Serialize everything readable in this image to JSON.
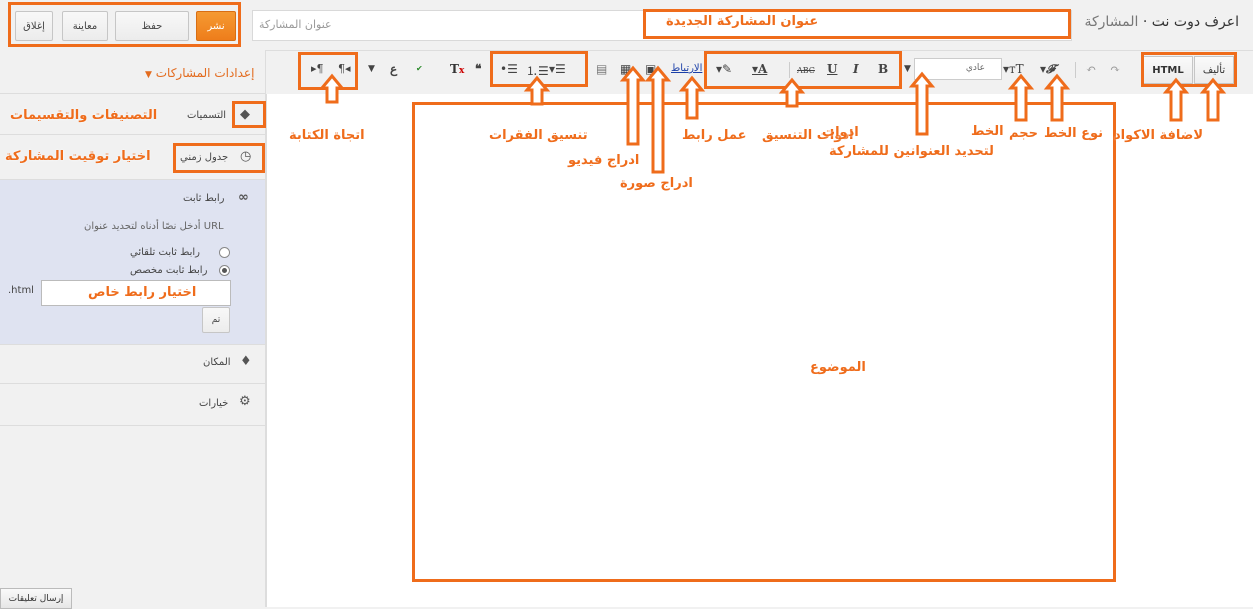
{
  "header": {
    "blog_title": "اعرف دوت نت",
    "separator": "·",
    "section": "المشاركة",
    "title_placeholder": "عنوان المشاركة",
    "buttons": {
      "publish": "نشر",
      "save": "حفظ",
      "preview": "معاينة",
      "close": "إغلاق"
    }
  },
  "toolbar": {
    "compose_label": "تأليف",
    "html_label": "HTML",
    "heading_select": "عادي",
    "link_label": "الارتباط",
    "bold": "B",
    "italic": "I",
    "underline": "U",
    "strike": "ABC",
    "font_color": "A",
    "quote": "❝",
    "clear_format": "T",
    "spell": "ABC",
    "rtl": "¶◂",
    "ltr": "▸¶"
  },
  "sidebar": {
    "settings_title": "إعدادات المشاركات",
    "labels_item": "التسميات",
    "schedule_item": "جدول زمني",
    "permalink_item": "رابط ثابت",
    "permalink_hint": "أدخل نصًا أدناه لتحديد عنوان URL",
    "radio_auto": "رابط ثابت تلقائي",
    "radio_custom": "رابط ثابت مخصص",
    "url_suffix": ".html",
    "done_button": "تم",
    "location_item": "المكان",
    "options_item": "خيارات"
  },
  "footer": {
    "feedback": "إرسال تعليقات"
  },
  "annotations": {
    "new_post_title": "عنوان المشاركة الجديدة",
    "categories": "التصنيفات والتقسيمات",
    "post_timing": "اختيار توقيت المشاركة",
    "custom_link": "اختيار رابط خاص",
    "writing_direction": "اتجاة الكتابة",
    "paragraph_format": "تنسيق الفقرات",
    "insert_video": "ادراج فيديو",
    "insert_image": "ادراج صورة",
    "make_link": "عمل رابط",
    "format_tools": "ادوات التنسيق",
    "headings_line1": "ادوات",
    "headings_line2": "لتحديد العنوانين للمشاركة",
    "font_size_line1": "الخط",
    "font_size_line2": "حجم",
    "font_type": "نوع الخط",
    "add_codes": "لاضافة الاكواد",
    "body": "الموضوع"
  },
  "colors": {
    "accent": "#ef6c1b",
    "publish": "#f08a24",
    "permalink_bg": "#dfe3f1"
  }
}
